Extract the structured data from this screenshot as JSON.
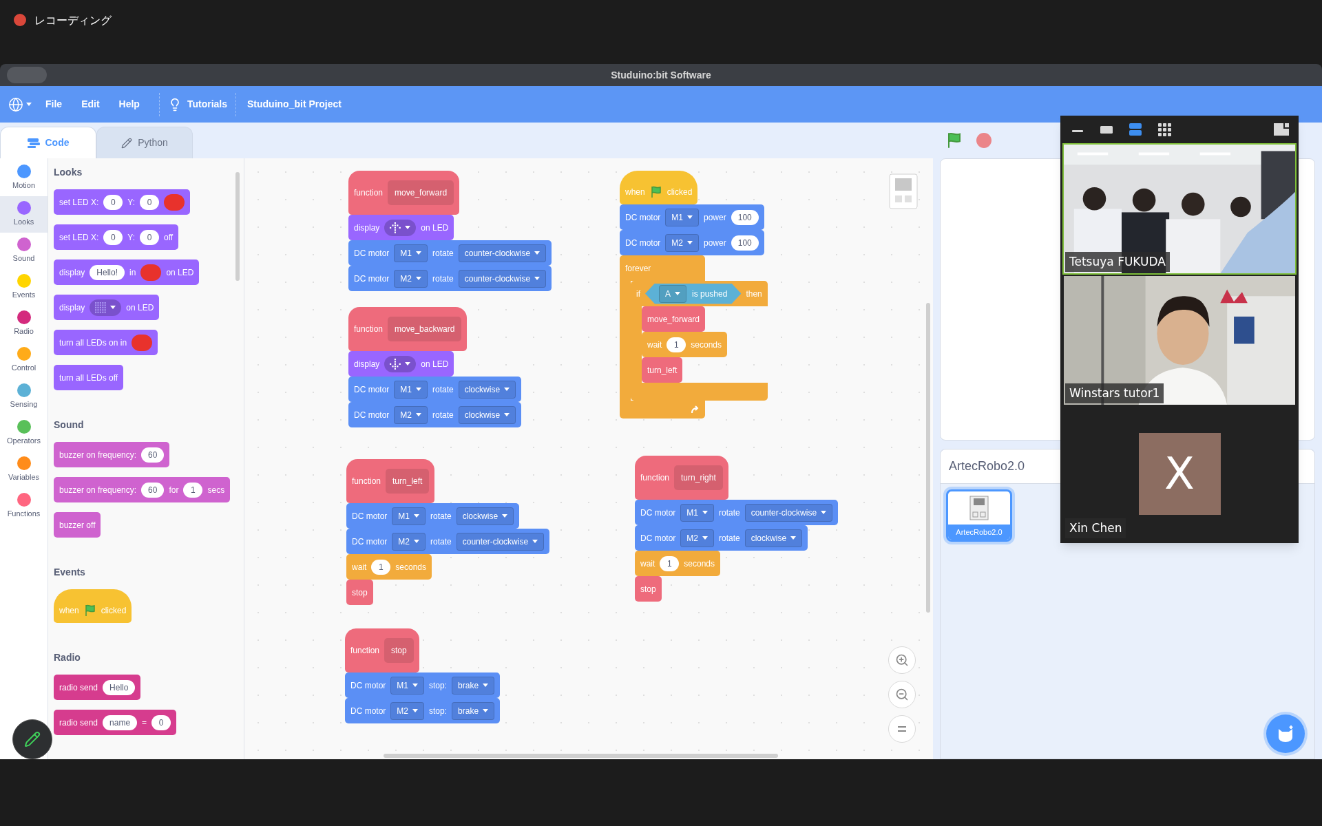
{
  "recording": {
    "label": "レコーディング"
  },
  "window": {
    "title": "Studuino:bit Software"
  },
  "menu": {
    "items": [
      "File",
      "Edit",
      "Help"
    ],
    "tutorials": "Tutorials",
    "project": "Studuino_bit Project"
  },
  "tabs": [
    {
      "label": "Code",
      "selected": true
    },
    {
      "label": "Python",
      "selected": false
    }
  ],
  "categories": [
    {
      "label": "Motion",
      "color": "#4c97ff",
      "selected": false
    },
    {
      "label": "Looks",
      "color": "#9966ff",
      "selected": true
    },
    {
      "label": "Sound",
      "color": "#cf63cf",
      "selected": false
    },
    {
      "label": "Events",
      "color": "#ffd500",
      "selected": false
    },
    {
      "label": "Radio",
      "color": "#d42a7d",
      "selected": false
    },
    {
      "label": "Control",
      "color": "#ffab19",
      "selected": false
    },
    {
      "label": "Sensing",
      "color": "#5cb1d6",
      "selected": false
    },
    {
      "label": "Operators",
      "color": "#59c059",
      "selected": false
    },
    {
      "label": "Variables",
      "color": "#ff8c1a",
      "selected": false
    },
    {
      "label": "Functions",
      "color": "#ff6680",
      "selected": false
    }
  ],
  "palette": {
    "sections": [
      {
        "title": "Looks",
        "blocks": [
          {
            "kind": "stack",
            "color": "#9966ff",
            "parts": [
              {
                "kind": "label",
                "text": "set LED X:"
              },
              {
                "kind": "number",
                "text": "0"
              },
              {
                "kind": "label",
                "text": "Y:"
              },
              {
                "kind": "number",
                "text": "0"
              },
              {
                "kind": "swatch",
                "color": "#e8322c"
              }
            ]
          },
          {
            "kind": "stack",
            "color": "#9966ff",
            "parts": [
              {
                "kind": "label",
                "text": "set LED X:"
              },
              {
                "kind": "number",
                "text": "0"
              },
              {
                "kind": "label",
                "text": "Y:"
              },
              {
                "kind": "number",
                "text": "0"
              },
              {
                "kind": "label",
                "text": "off"
              }
            ]
          },
          {
            "kind": "stack",
            "color": "#9966ff",
            "parts": [
              {
                "kind": "label",
                "text": "display"
              },
              {
                "kind": "text",
                "text": "Hello!"
              },
              {
                "kind": "label",
                "text": "in"
              },
              {
                "kind": "swatch",
                "color": "#e8322c"
              },
              {
                "kind": "label",
                "text": "on LED"
              }
            ]
          },
          {
            "kind": "stack",
            "color": "#9966ff",
            "parts": [
              {
                "kind": "label",
                "text": "display"
              },
              {
                "kind": "ledgrid"
              },
              {
                "kind": "label",
                "text": "on LED"
              }
            ]
          },
          {
            "kind": "stack",
            "color": "#9966ff",
            "parts": [
              {
                "kind": "label",
                "text": "turn all LEDs on in"
              },
              {
                "kind": "swatch",
                "color": "#e8322c"
              }
            ]
          },
          {
            "kind": "stack",
            "color": "#9966ff",
            "parts": [
              {
                "kind": "label",
                "text": "turn all LEDs off"
              }
            ]
          }
        ]
      },
      {
        "title": "Sound",
        "blocks": [
          {
            "kind": "stack",
            "color": "#cf63cf",
            "parts": [
              {
                "kind": "label",
                "text": "buzzer on frequency:"
              },
              {
                "kind": "number",
                "text": "60"
              }
            ]
          },
          {
            "kind": "stack",
            "color": "#cf63cf",
            "parts": [
              {
                "kind": "label",
                "text": "buzzer on frequency:"
              },
              {
                "kind": "number",
                "text": "60"
              },
              {
                "kind": "label",
                "text": "for"
              },
              {
                "kind": "number",
                "text": "1"
              },
              {
                "kind": "label",
                "text": "secs"
              }
            ]
          },
          {
            "kind": "stack",
            "color": "#cf63cf",
            "parts": [
              {
                "kind": "label",
                "text": "buzzer off"
              }
            ]
          }
        ]
      },
      {
        "title": "Events",
        "blocks": [
          {
            "kind": "hat",
            "color": "#f7c232",
            "parts": [
              {
                "kind": "label",
                "text": "when"
              },
              {
                "kind": "flag"
              },
              {
                "kind": "label",
                "text": "clicked"
              }
            ]
          }
        ]
      },
      {
        "title": "Radio",
        "blocks": [
          {
            "kind": "stack",
            "color": "#d63c8e",
            "parts": [
              {
                "kind": "label",
                "text": "radio send"
              },
              {
                "kind": "text",
                "text": "Hello"
              }
            ]
          },
          {
            "kind": "stack",
            "color": "#d63c8e",
            "parts": [
              {
                "kind": "label",
                "text": "radio send"
              },
              {
                "kind": "text",
                "text": "name"
              },
              {
                "kind": "label",
                "text": "="
              },
              {
                "kind": "number",
                "text": "0"
              }
            ]
          }
        ]
      }
    ]
  },
  "scripts": [
    {
      "blocks": [
        {
          "kind": "define",
          "color": "#ee6b7c",
          "parts": [
            {
              "kind": "label",
              "text": "function"
            },
            {
              "kind": "proc",
              "text": "move_forward"
            }
          ]
        },
        {
          "kind": "stack",
          "color": "#9966ff",
          "parts": [
            {
              "kind": "label",
              "text": "display"
            },
            {
              "kind": "ledup"
            },
            {
              "kind": "label",
              "text": "on LED"
            }
          ]
        },
        {
          "kind": "stack",
          "color": "#5b8ff5",
          "parts": [
            {
              "kind": "label",
              "text": "DC motor"
            },
            {
              "kind": "menu",
              "text": "M1"
            },
            {
              "kind": "label",
              "text": "rotate"
            },
            {
              "kind": "menu",
              "text": "counter-clockwise"
            }
          ]
        },
        {
          "kind": "stack",
          "color": "#5b8ff5",
          "parts": [
            {
              "kind": "label",
              "text": "DC motor"
            },
            {
              "kind": "menu",
              "text": "M2"
            },
            {
              "kind": "label",
              "text": "rotate"
            },
            {
              "kind": "menu",
              "text": "counter-clockwise"
            }
          ]
        }
      ]
    },
    {
      "blocks": [
        {
          "kind": "define",
          "color": "#ee6b7c",
          "parts": [
            {
              "kind": "label",
              "text": "function"
            },
            {
              "kind": "proc",
              "text": "move_backward"
            }
          ]
        },
        {
          "kind": "stack",
          "color": "#9966ff",
          "parts": [
            {
              "kind": "label",
              "text": "display"
            },
            {
              "kind": "leddown"
            },
            {
              "kind": "label",
              "text": "on LED"
            }
          ]
        },
        {
          "kind": "stack",
          "color": "#5b8ff5",
          "parts": [
            {
              "kind": "label",
              "text": "DC motor"
            },
            {
              "kind": "menu",
              "text": "M1"
            },
            {
              "kind": "label",
              "text": "rotate"
            },
            {
              "kind": "menu",
              "text": "clockwise"
            }
          ]
        },
        {
          "kind": "stack",
          "color": "#5b8ff5",
          "parts": [
            {
              "kind": "label",
              "text": "DC motor"
            },
            {
              "kind": "menu",
              "text": "M2"
            },
            {
              "kind": "label",
              "text": "rotate"
            },
            {
              "kind": "menu",
              "text": "clockwise"
            }
          ]
        }
      ]
    },
    {
      "blocks": [
        {
          "kind": "define",
          "color": "#ee6b7c",
          "parts": [
            {
              "kind": "label",
              "text": "function"
            },
            {
              "kind": "proc",
              "text": "turn_left"
            }
          ]
        },
        {
          "kind": "stack",
          "color": "#5b8ff5",
          "parts": [
            {
              "kind": "label",
              "text": "DC motor"
            },
            {
              "kind": "menu",
              "text": "M1"
            },
            {
              "kind": "label",
              "text": "rotate"
            },
            {
              "kind": "menu",
              "text": "clockwise"
            }
          ]
        },
        {
          "kind": "stack",
          "color": "#5b8ff5",
          "parts": [
            {
              "kind": "label",
              "text": "DC motor"
            },
            {
              "kind": "menu",
              "text": "M2"
            },
            {
              "kind": "label",
              "text": "rotate"
            },
            {
              "kind": "menu",
              "text": "counter-clockwise"
            }
          ]
        },
        {
          "kind": "stack",
          "color": "#f2ab3c",
          "parts": [
            {
              "kind": "label",
              "text": "wait"
            },
            {
              "kind": "number",
              "text": "1"
            },
            {
              "kind": "label",
              "text": "seconds"
            }
          ]
        },
        {
          "kind": "stack",
          "color": "#ee6b7c",
          "parts": [
            {
              "kind": "label",
              "text": "stop"
            }
          ]
        }
      ]
    },
    {
      "blocks": [
        {
          "kind": "define",
          "color": "#ee6b7c",
          "parts": [
            {
              "kind": "label",
              "text": "function"
            },
            {
              "kind": "proc",
              "text": "stop"
            }
          ]
        },
        {
          "kind": "stack",
          "color": "#5b8ff5",
          "parts": [
            {
              "kind": "label",
              "text": "DC motor"
            },
            {
              "kind": "menu",
              "text": "M1"
            },
            {
              "kind": "label",
              "text": "stop:"
            },
            {
              "kind": "menu",
              "text": "brake"
            }
          ]
        },
        {
          "kind": "stack",
          "color": "#5b8ff5",
          "parts": [
            {
              "kind": "label",
              "text": "DC motor"
            },
            {
              "kind": "menu",
              "text": "M2"
            },
            {
              "kind": "label",
              "text": "stop:"
            },
            {
              "kind": "menu",
              "text": "brake"
            }
          ]
        }
      ]
    },
    {
      "blocks": [
        {
          "kind": "hat",
          "color": "#f7c232",
          "parts": [
            {
              "kind": "label",
              "text": "when"
            },
            {
              "kind": "flag"
            },
            {
              "kind": "label",
              "text": "clicked"
            }
          ]
        },
        {
          "kind": "stack",
          "color": "#5b8ff5",
          "parts": [
            {
              "kind": "label",
              "text": "DC motor"
            },
            {
              "kind": "menu",
              "text": "M1"
            },
            {
              "kind": "label",
              "text": "power"
            },
            {
              "kind": "number",
              "text": "100"
            }
          ]
        },
        {
          "kind": "stack",
          "color": "#5b8ff5",
          "parts": [
            {
              "kind": "label",
              "text": "DC motor"
            },
            {
              "kind": "menu",
              "text": "M2"
            },
            {
              "kind": "label",
              "text": "power"
            },
            {
              "kind": "number",
              "text": "100"
            }
          ]
        },
        {
          "kind": "c",
          "color": "#f2ab3c",
          "loop": true,
          "parts": [
            {
              "kind": "label",
              "text": "forever"
            }
          ],
          "children": [
            {
              "kind": "c",
              "color": "#f2ab3c",
              "loop": false,
              "parts": [
                {
                  "kind": "label",
                  "text": "if"
                },
                {
                  "kind": "bool",
                  "color": "#5cb1d6",
                  "parts": [
                    {
                      "kind": "menu",
                      "text": "A"
                    },
                    {
                      "kind": "label",
                      "text": "is pushed"
                    }
                  ]
                },
                {
                  "kind": "label",
                  "text": "then"
                }
              ],
              "children": [
                {
                  "kind": "stack",
                  "color": "#ee6b7c",
                  "parts": [
                    {
                      "kind": "label",
                      "text": "move_forward"
                    }
                  ]
                },
                {
                  "kind": "stack",
                  "color": "#f2ab3c",
                  "parts": [
                    {
                      "kind": "label",
                      "text": "wait"
                    },
                    {
                      "kind": "number",
                      "text": "1"
                    },
                    {
                      "kind": "label",
                      "text": "seconds"
                    }
                  ]
                },
                {
                  "kind": "stack",
                  "color": "#ee6b7c",
                  "parts": [
                    {
                      "kind": "label",
                      "text": "turn_left"
                    }
                  ]
                }
              ]
            }
          ]
        }
      ]
    },
    {
      "blocks": [
        {
          "kind": "define",
          "color": "#ee6b7c",
          "parts": [
            {
              "kind": "label",
              "text": "function"
            },
            {
              "kind": "proc",
              "text": "turn_right"
            }
          ]
        },
        {
          "kind": "stack",
          "color": "#5b8ff5",
          "parts": [
            {
              "kind": "label",
              "text": "DC motor"
            },
            {
              "kind": "menu",
              "text": "M1"
            },
            {
              "kind": "label",
              "text": "rotate"
            },
            {
              "kind": "menu",
              "text": "counter-clockwise"
            }
          ]
        },
        {
          "kind": "stack",
          "color": "#5b8ff5",
          "parts": [
            {
              "kind": "label",
              "text": "DC motor"
            },
            {
              "kind": "menu",
              "text": "M2"
            },
            {
              "kind": "label",
              "text": "rotate"
            },
            {
              "kind": "menu",
              "text": "clockwise"
            }
          ]
        },
        {
          "kind": "stack",
          "color": "#f2ab3c",
          "parts": [
            {
              "kind": "label",
              "text": "wait"
            },
            {
              "kind": "number",
              "text": "1"
            },
            {
              "kind": "label",
              "text": "seconds"
            }
          ]
        },
        {
          "kind": "stack",
          "color": "#ee6b7c",
          "parts": [
            {
              "kind": "label",
              "text": "stop"
            }
          ]
        }
      ]
    }
  ],
  "sprites": {
    "title": "ArtecRobo2.0",
    "items": [
      {
        "name": "ArtecRobo2.0",
        "selected": true
      }
    ]
  },
  "video": {
    "view_modes": [
      {
        "selected": false
      },
      {
        "selected": false
      },
      {
        "selected": true
      },
      {
        "selected": false
      }
    ],
    "tiles": [
      {
        "kind": "classroom",
        "name": "Tetsuya FUKUDA",
        "active": true
      },
      {
        "kind": "office",
        "name": "Winstars tutor1",
        "active": false
      },
      {
        "kind": "avatar",
        "name": "Xin Chen",
        "initial": "X",
        "active": false
      }
    ]
  }
}
